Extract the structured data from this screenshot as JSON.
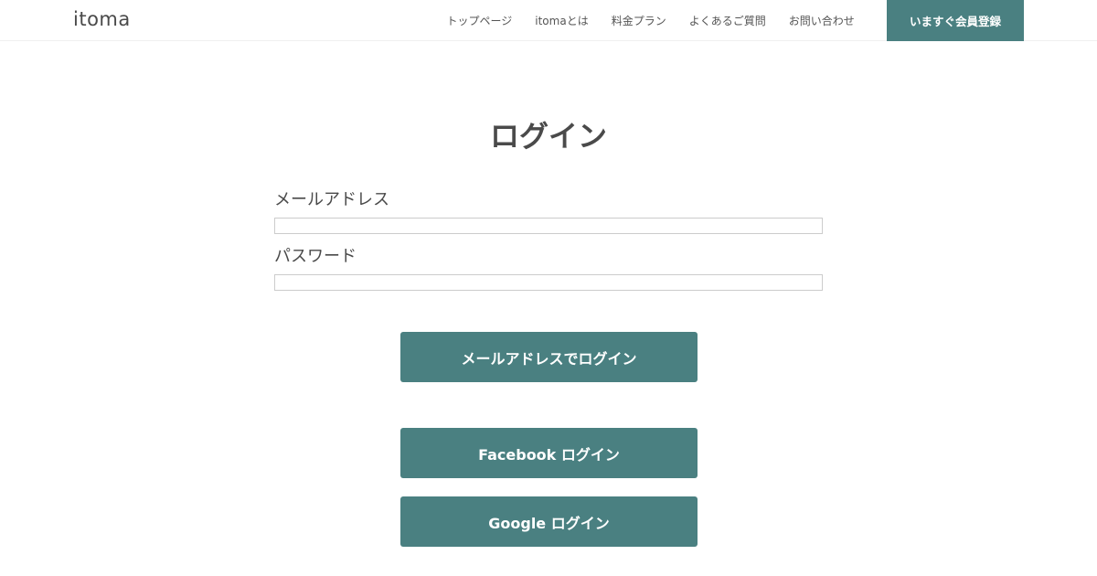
{
  "header": {
    "logo": "itoma",
    "nav": [
      {
        "label": "トップページ"
      },
      {
        "label": "itomaとは"
      },
      {
        "label": "料金プラン"
      },
      {
        "label": "よくあるご質問"
      },
      {
        "label": "お問い合わせ"
      }
    ],
    "signup_label": "いますぐ会員登録"
  },
  "main": {
    "title": "ログイン",
    "email_label": "メールアドレス",
    "email_value": "",
    "email_placeholder": "",
    "password_label": "パスワード",
    "password_value": "",
    "password_placeholder": "",
    "email_login_label": "メールアドレスでログイン",
    "facebook_login_label": "Facebook ログイン",
    "google_login_label": "Google ログイン"
  },
  "colors": {
    "accent": "#4a8081",
    "text": "#4a4a4a",
    "input_border": "#cccccc"
  }
}
